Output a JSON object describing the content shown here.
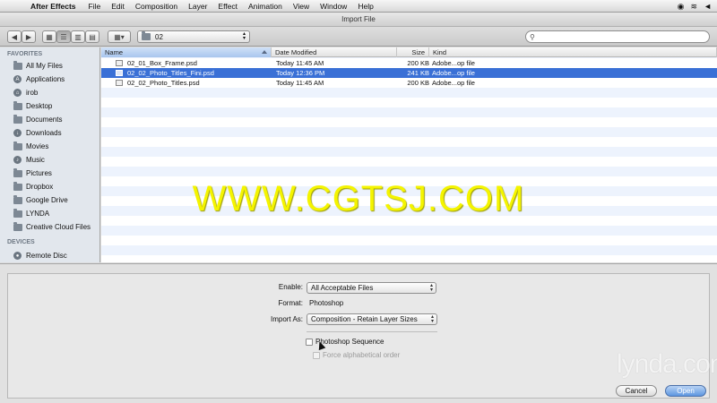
{
  "menubar": {
    "app_name": "After Effects",
    "items": [
      "File",
      "Edit",
      "Composition",
      "Layer",
      "Effect",
      "Animation",
      "View",
      "Window",
      "Help"
    ]
  },
  "window": {
    "title": "Import File"
  },
  "toolbar": {
    "back": "◀",
    "forward": "▶",
    "arrange": "▦▾",
    "location": "02",
    "search_placeholder": ""
  },
  "sidebar": {
    "favorites_heading": "FAVORITES",
    "favorites": [
      {
        "label": "All My Files",
        "icon": "all-files-icon"
      },
      {
        "label": "Applications",
        "icon": "applications-icon"
      },
      {
        "label": "irob",
        "icon": "home-icon"
      },
      {
        "label": "Desktop",
        "icon": "desktop-icon"
      },
      {
        "label": "Documents",
        "icon": "documents-icon"
      },
      {
        "label": "Downloads",
        "icon": "downloads-icon"
      },
      {
        "label": "Movies",
        "icon": "movies-icon"
      },
      {
        "label": "Music",
        "icon": "music-icon"
      },
      {
        "label": "Pictures",
        "icon": "pictures-icon"
      },
      {
        "label": "Dropbox",
        "icon": "folder-icon"
      },
      {
        "label": "Google Drive",
        "icon": "folder-icon"
      },
      {
        "label": "LYNDA",
        "icon": "folder-icon"
      },
      {
        "label": "Creative Cloud Files",
        "icon": "folder-icon"
      }
    ],
    "devices_heading": "DEVICES",
    "devices": [
      {
        "label": "Remote Disc",
        "icon": "disc-icon"
      }
    ]
  },
  "filelist": {
    "columns": {
      "name": "Name",
      "date": "Date Modified",
      "size": "Size",
      "kind": "Kind"
    },
    "rows": [
      {
        "name": "02_01_Box_Frame.psd",
        "date": "Today 11:45 AM",
        "size": "200 KB",
        "kind": "Adobe...op file",
        "selected": false
      },
      {
        "name": "02_02_Photo_Titles_Fini.psd",
        "date": "Today 12:36 PM",
        "size": "241 KB",
        "kind": "Adobe...op file",
        "selected": true
      },
      {
        "name": "02_02_Photo_Titles.psd",
        "date": "Today 11:45 AM",
        "size": "200 KB",
        "kind": "Adobe...op file",
        "selected": false
      }
    ]
  },
  "watermark": "WWW.CGTSJ.COM",
  "options": {
    "enable_label": "Enable:",
    "enable_value": "All Acceptable Files",
    "format_label": "Format:",
    "format_value": "Photoshop",
    "import_as_label": "Import As:",
    "import_as_value": "Composition - Retain Layer Sizes",
    "photoshop_sequence": "Photoshop Sequence",
    "force_alpha": "Force alphabetical order"
  },
  "buttons": {
    "cancel": "Cancel",
    "open": "Open"
  },
  "logo": "lynda.com",
  "colors": {
    "selection": "#3a70d6",
    "watermark": "#f4f400"
  }
}
